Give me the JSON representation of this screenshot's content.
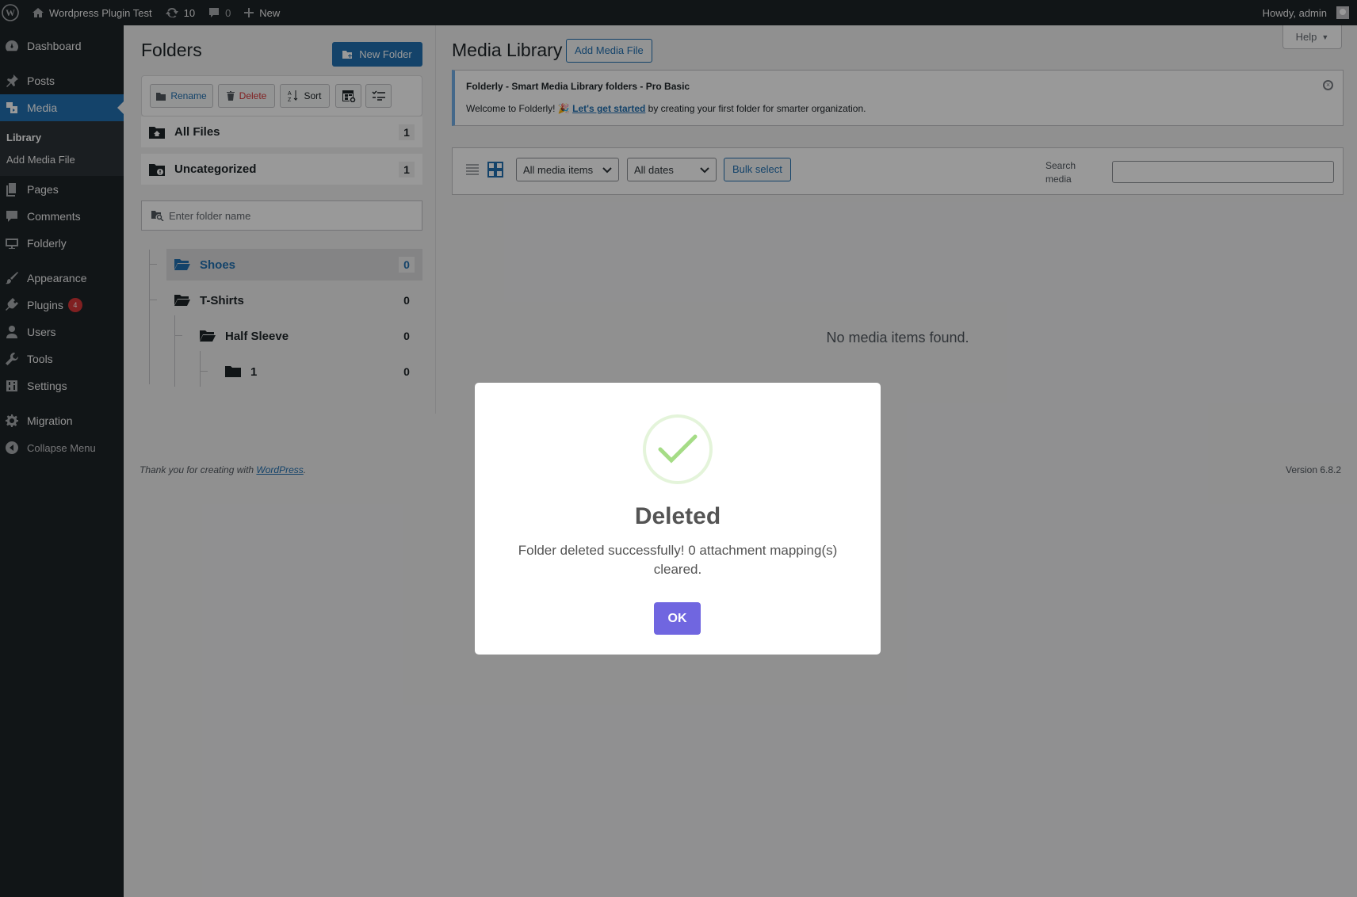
{
  "adminbar": {
    "site_name": "Wordpress Plugin Test",
    "updates_count": "10",
    "comments_count": "0",
    "new_label": "New",
    "howdy": "Howdy, admin"
  },
  "sidebar": {
    "items": [
      {
        "label": "Dashboard",
        "icon": "dashboard-icon"
      },
      {
        "label": "Posts",
        "icon": "pin-icon"
      },
      {
        "label": "Media",
        "icon": "media-icon"
      },
      {
        "label": "Pages",
        "icon": "pages-icon"
      },
      {
        "label": "Comments",
        "icon": "comment-icon"
      },
      {
        "label": "Folderly",
        "icon": "folderly-icon"
      },
      {
        "label": "Appearance",
        "icon": "brush-icon"
      },
      {
        "label": "Plugins",
        "icon": "plugin-icon",
        "badge": "4"
      },
      {
        "label": "Users",
        "icon": "user-icon"
      },
      {
        "label": "Tools",
        "icon": "wrench-icon"
      },
      {
        "label": "Settings",
        "icon": "settings-icon"
      },
      {
        "label": "Migration",
        "icon": "gear-icon"
      }
    ],
    "submenu": {
      "library": "Library",
      "add_media": "Add Media File"
    },
    "collapse": "Collapse Menu"
  },
  "folders": {
    "title": "Folders",
    "new_folder": "New Folder",
    "rename": "Rename",
    "delete": "Delete",
    "sort": "Sort",
    "all_files": {
      "label": "All Files",
      "count": "1"
    },
    "uncategorized": {
      "label": "Uncategorized",
      "count": "1"
    },
    "search_placeholder": "Enter folder name",
    "tree": [
      {
        "label": "Shoes",
        "count": "0"
      },
      {
        "label": "T-Shirts",
        "count": "0"
      },
      {
        "label": "Half Sleeve",
        "count": "0"
      },
      {
        "label": "1",
        "count": "0"
      }
    ]
  },
  "main": {
    "title": "Media Library",
    "add_media": "Add Media File",
    "help": "Help",
    "notice_title": "Folderly - Smart Media Library folders - Pro Basic",
    "notice_pre": "Welcome to Folderly! 🎉",
    "notice_link": "Let's get started",
    "notice_post": "by creating your first folder for smarter organization.",
    "filter_type": "All media items",
    "filter_date": "All dates",
    "bulk_select": "Bulk select",
    "search_label": "Search media",
    "empty": "No media items found."
  },
  "footer": {
    "thanks": "Thank you for creating with",
    "wp_link": "WordPress",
    "period": ".",
    "version": "Version 6.8.2"
  },
  "modal": {
    "title": "Deleted",
    "text": "Folder deleted successfully! 0 attachment mapping(s) cleared.",
    "ok": "OK"
  },
  "colors": {
    "accent": "#2271b1",
    "ok_button": "#7066e0",
    "success": "#a5dc86",
    "badge": "#d63638"
  }
}
